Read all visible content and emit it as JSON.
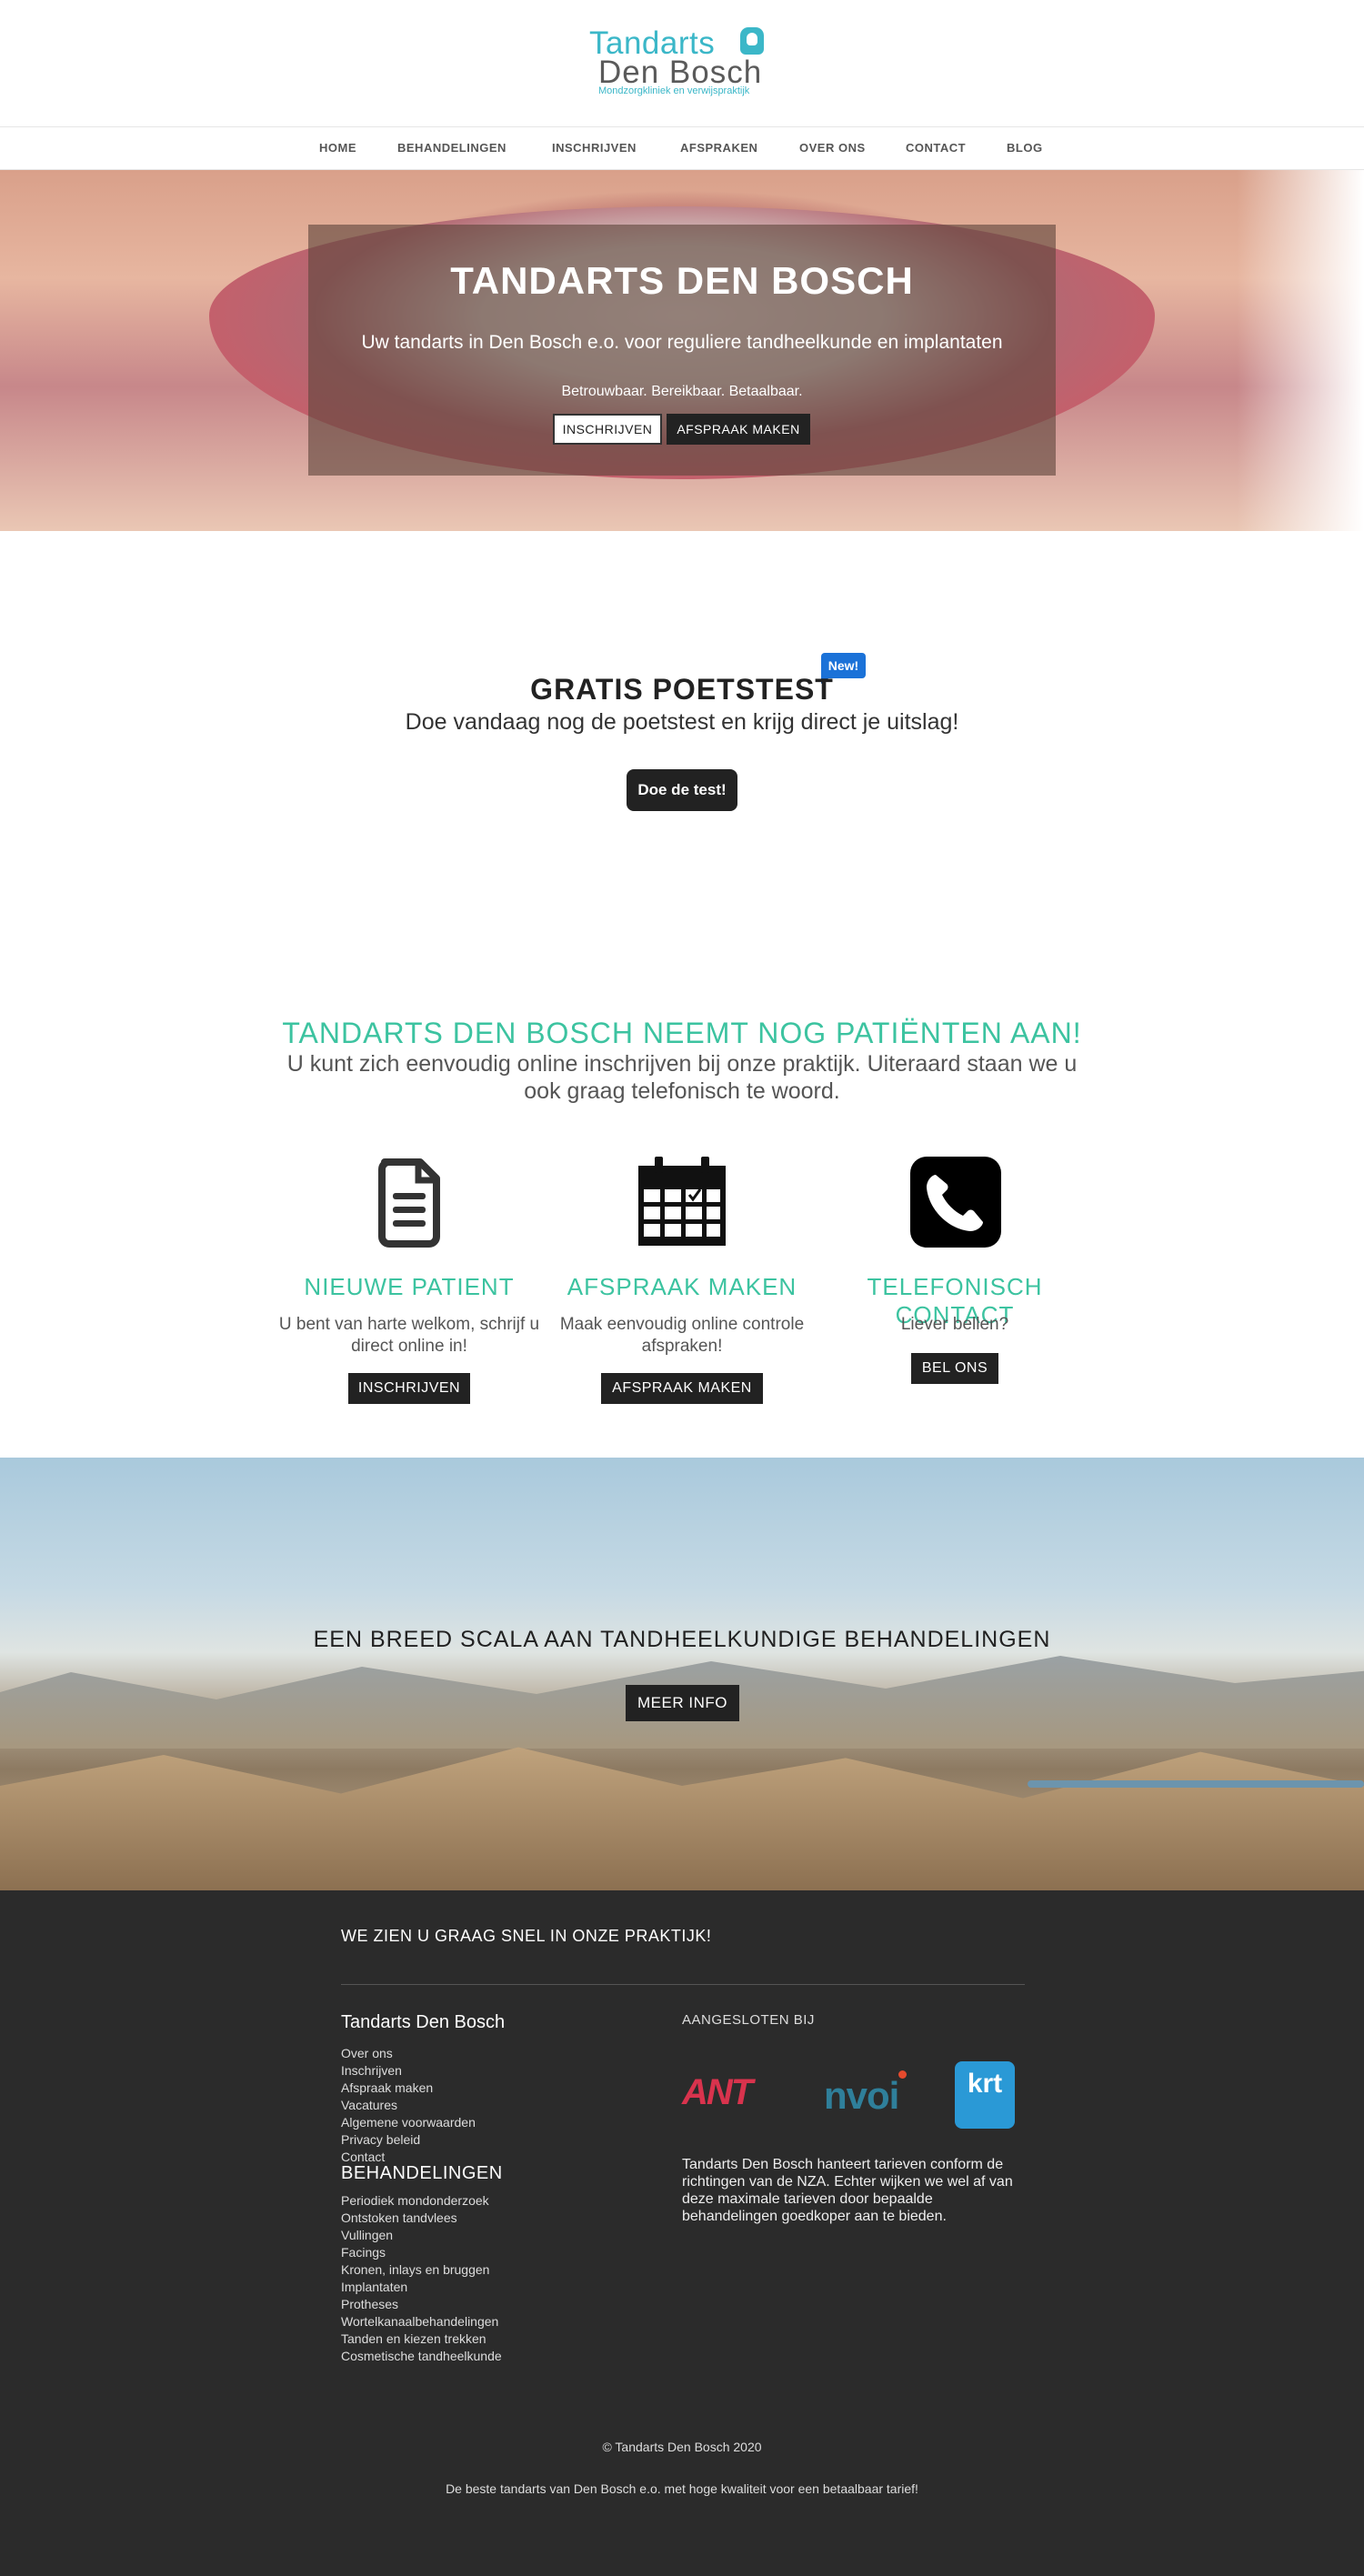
{
  "logo": {
    "line1": "Tandarts",
    "line2": "Den Bosch",
    "subtitle": "Mondzorgkliniek en verwijspraktijk"
  },
  "nav": {
    "items": [
      {
        "label": "HOME"
      },
      {
        "label": "BEHANDELINGEN"
      },
      {
        "label": "INSCHRIJVEN"
      },
      {
        "label": "AFSPRAKEN"
      },
      {
        "label": "OVER ONS"
      },
      {
        "label": "CONTACT"
      },
      {
        "label": "BLOG"
      }
    ]
  },
  "hero": {
    "title": "TANDARTS DEN BOSCH",
    "subtitle": "Uw tandarts in Den Bosch e.o. voor reguliere tandheelkunde en implantaten",
    "tagline": "Betrouwbaar. Bereikbaar. Betaalbaar.",
    "button_inschrijven": "INSCHRIJVEN",
    "button_afspraak": "AFSPRAAK MAKEN"
  },
  "poetstest": {
    "badge": "New!",
    "title": "GRATIS POETSTEST",
    "subtitle": "Doe vandaag nog de poetstest en krijg direct je uitslag!",
    "button": "Doe de test!"
  },
  "patients": {
    "title": "TANDARTS DEN BOSCH NEEMT NOG PATIËNTEN AAN!",
    "subtitle": "U kunt zich eenvoudig online inschrijven bij onze praktijk. Uiteraard staan we u ook graag telefonisch te woord.",
    "columns": [
      {
        "icon": "document-icon",
        "title": "NIEUWE PATIENT",
        "text": "U bent van harte welkom, schrijf u direct online in!",
        "button": "INSCHRIJVEN"
      },
      {
        "icon": "calendar-icon",
        "title": "AFSPRAAK MAKEN",
        "text": "Maak eenvoudig online controle afspraken!",
        "button": "AFSPRAAK MAKEN"
      },
      {
        "icon": "phone-icon",
        "title": "TELEFONISCH CONTACT",
        "text": "Liever bellen?",
        "button": "BEL ONS"
      }
    ]
  },
  "treatments_banner": {
    "title": "EEN BREED SCALA AAN TANDHEELKUNDIGE BEHANDELINGEN",
    "button": "MEER INFO"
  },
  "footer": {
    "heading": "WE ZIEN U GRAAG SNEL IN ONZE PRAKTIJK!",
    "col_practice_title": "Tandarts Den Bosch",
    "practice_links": [
      "Over ons",
      "Inschrijven",
      "Afspraak maken",
      "Vacatures",
      "Algemene voorwaarden",
      "Privacy beleid",
      "Contact"
    ],
    "col_treatments_title": "BEHANDELINGEN",
    "treatment_links": [
      "Periodiek mondonderzoek",
      "Ontstoken tandvlees",
      "Vullingen",
      "Facings",
      "Kronen, inlays en bruggen",
      "Implantaten",
      "Protheses",
      "Wortelkanaalbehandelingen",
      "Tanden en kiezen trekken",
      "Cosmetische tandheelkunde"
    ],
    "affiliated_title": "AANGESLOTEN BIJ",
    "affiliates": {
      "ant": "ANT",
      "nvoi": "nvoi",
      "krt": "krt"
    },
    "nza_text": "Tandarts Den Bosch hanteert tarieven conform de richtingen van de NZA. Echter wijken we wel af van deze maximale tarieven door bepaalde behandelingen goedkoper aan te bieden.",
    "copyright": "© Tandarts Den Bosch 2020",
    "tagline": "De beste tandarts van Den Bosch e.o. met hoge kwaliteit voor een betaalbaar tarief!"
  },
  "colors": {
    "accent_teal": "#3cc3a0",
    "logo_blue": "#3bb7c8",
    "dark": "#222222",
    "footer_bg": "#2b2b2b",
    "badge_blue": "#1b72d8"
  }
}
